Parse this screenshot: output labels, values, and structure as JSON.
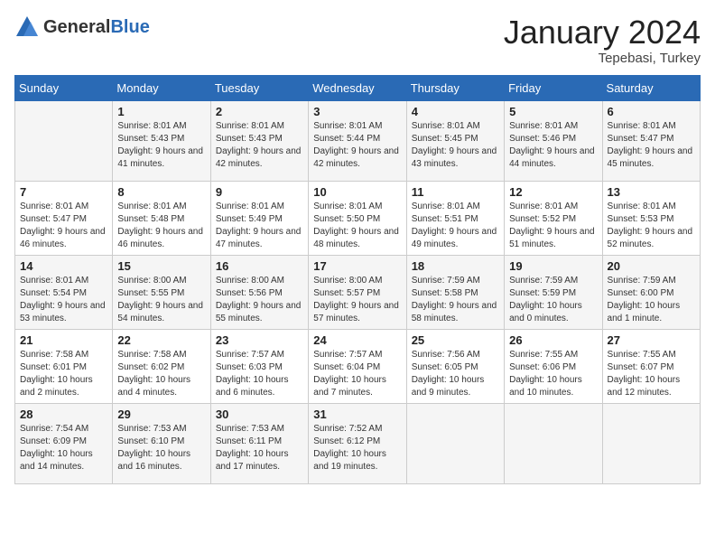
{
  "header": {
    "logo_general": "General",
    "logo_blue": "Blue",
    "month_title": "January 2024",
    "location": "Tepebasi, Turkey"
  },
  "columns": [
    "Sunday",
    "Monday",
    "Tuesday",
    "Wednesday",
    "Thursday",
    "Friday",
    "Saturday"
  ],
  "weeks": [
    [
      {
        "day": "",
        "sunrise": "",
        "sunset": "",
        "daylight": ""
      },
      {
        "day": "1",
        "sunrise": "Sunrise: 8:01 AM",
        "sunset": "Sunset: 5:43 PM",
        "daylight": "Daylight: 9 hours and 41 minutes."
      },
      {
        "day": "2",
        "sunrise": "Sunrise: 8:01 AM",
        "sunset": "Sunset: 5:43 PM",
        "daylight": "Daylight: 9 hours and 42 minutes."
      },
      {
        "day": "3",
        "sunrise": "Sunrise: 8:01 AM",
        "sunset": "Sunset: 5:44 PM",
        "daylight": "Daylight: 9 hours and 42 minutes."
      },
      {
        "day": "4",
        "sunrise": "Sunrise: 8:01 AM",
        "sunset": "Sunset: 5:45 PM",
        "daylight": "Daylight: 9 hours and 43 minutes."
      },
      {
        "day": "5",
        "sunrise": "Sunrise: 8:01 AM",
        "sunset": "Sunset: 5:46 PM",
        "daylight": "Daylight: 9 hours and 44 minutes."
      },
      {
        "day": "6",
        "sunrise": "Sunrise: 8:01 AM",
        "sunset": "Sunset: 5:47 PM",
        "daylight": "Daylight: 9 hours and 45 minutes."
      }
    ],
    [
      {
        "day": "7",
        "sunrise": "Sunrise: 8:01 AM",
        "sunset": "Sunset: 5:47 PM",
        "daylight": "Daylight: 9 hours and 46 minutes."
      },
      {
        "day": "8",
        "sunrise": "Sunrise: 8:01 AM",
        "sunset": "Sunset: 5:48 PM",
        "daylight": "Daylight: 9 hours and 46 minutes."
      },
      {
        "day": "9",
        "sunrise": "Sunrise: 8:01 AM",
        "sunset": "Sunset: 5:49 PM",
        "daylight": "Daylight: 9 hours and 47 minutes."
      },
      {
        "day": "10",
        "sunrise": "Sunrise: 8:01 AM",
        "sunset": "Sunset: 5:50 PM",
        "daylight": "Daylight: 9 hours and 48 minutes."
      },
      {
        "day": "11",
        "sunrise": "Sunrise: 8:01 AM",
        "sunset": "Sunset: 5:51 PM",
        "daylight": "Daylight: 9 hours and 49 minutes."
      },
      {
        "day": "12",
        "sunrise": "Sunrise: 8:01 AM",
        "sunset": "Sunset: 5:52 PM",
        "daylight": "Daylight: 9 hours and 51 minutes."
      },
      {
        "day": "13",
        "sunrise": "Sunrise: 8:01 AM",
        "sunset": "Sunset: 5:53 PM",
        "daylight": "Daylight: 9 hours and 52 minutes."
      }
    ],
    [
      {
        "day": "14",
        "sunrise": "Sunrise: 8:01 AM",
        "sunset": "Sunset: 5:54 PM",
        "daylight": "Daylight: 9 hours and 53 minutes."
      },
      {
        "day": "15",
        "sunrise": "Sunrise: 8:00 AM",
        "sunset": "Sunset: 5:55 PM",
        "daylight": "Daylight: 9 hours and 54 minutes."
      },
      {
        "day": "16",
        "sunrise": "Sunrise: 8:00 AM",
        "sunset": "Sunset: 5:56 PM",
        "daylight": "Daylight: 9 hours and 55 minutes."
      },
      {
        "day": "17",
        "sunrise": "Sunrise: 8:00 AM",
        "sunset": "Sunset: 5:57 PM",
        "daylight": "Daylight: 9 hours and 57 minutes."
      },
      {
        "day": "18",
        "sunrise": "Sunrise: 7:59 AM",
        "sunset": "Sunset: 5:58 PM",
        "daylight": "Daylight: 9 hours and 58 minutes."
      },
      {
        "day": "19",
        "sunrise": "Sunrise: 7:59 AM",
        "sunset": "Sunset: 5:59 PM",
        "daylight": "Daylight: 10 hours and 0 minutes."
      },
      {
        "day": "20",
        "sunrise": "Sunrise: 7:59 AM",
        "sunset": "Sunset: 6:00 PM",
        "daylight": "Daylight: 10 hours and 1 minute."
      }
    ],
    [
      {
        "day": "21",
        "sunrise": "Sunrise: 7:58 AM",
        "sunset": "Sunset: 6:01 PM",
        "daylight": "Daylight: 10 hours and 2 minutes."
      },
      {
        "day": "22",
        "sunrise": "Sunrise: 7:58 AM",
        "sunset": "Sunset: 6:02 PM",
        "daylight": "Daylight: 10 hours and 4 minutes."
      },
      {
        "day": "23",
        "sunrise": "Sunrise: 7:57 AM",
        "sunset": "Sunset: 6:03 PM",
        "daylight": "Daylight: 10 hours and 6 minutes."
      },
      {
        "day": "24",
        "sunrise": "Sunrise: 7:57 AM",
        "sunset": "Sunset: 6:04 PM",
        "daylight": "Daylight: 10 hours and 7 minutes."
      },
      {
        "day": "25",
        "sunrise": "Sunrise: 7:56 AM",
        "sunset": "Sunset: 6:05 PM",
        "daylight": "Daylight: 10 hours and 9 minutes."
      },
      {
        "day": "26",
        "sunrise": "Sunrise: 7:55 AM",
        "sunset": "Sunset: 6:06 PM",
        "daylight": "Daylight: 10 hours and 10 minutes."
      },
      {
        "day": "27",
        "sunrise": "Sunrise: 7:55 AM",
        "sunset": "Sunset: 6:07 PM",
        "daylight": "Daylight: 10 hours and 12 minutes."
      }
    ],
    [
      {
        "day": "28",
        "sunrise": "Sunrise: 7:54 AM",
        "sunset": "Sunset: 6:09 PM",
        "daylight": "Daylight: 10 hours and 14 minutes."
      },
      {
        "day": "29",
        "sunrise": "Sunrise: 7:53 AM",
        "sunset": "Sunset: 6:10 PM",
        "daylight": "Daylight: 10 hours and 16 minutes."
      },
      {
        "day": "30",
        "sunrise": "Sunrise: 7:53 AM",
        "sunset": "Sunset: 6:11 PM",
        "daylight": "Daylight: 10 hours and 17 minutes."
      },
      {
        "day": "31",
        "sunrise": "Sunrise: 7:52 AM",
        "sunset": "Sunset: 6:12 PM",
        "daylight": "Daylight: 10 hours and 19 minutes."
      },
      {
        "day": "",
        "sunrise": "",
        "sunset": "",
        "daylight": ""
      },
      {
        "day": "",
        "sunrise": "",
        "sunset": "",
        "daylight": ""
      },
      {
        "day": "",
        "sunrise": "",
        "sunset": "",
        "daylight": ""
      }
    ]
  ]
}
